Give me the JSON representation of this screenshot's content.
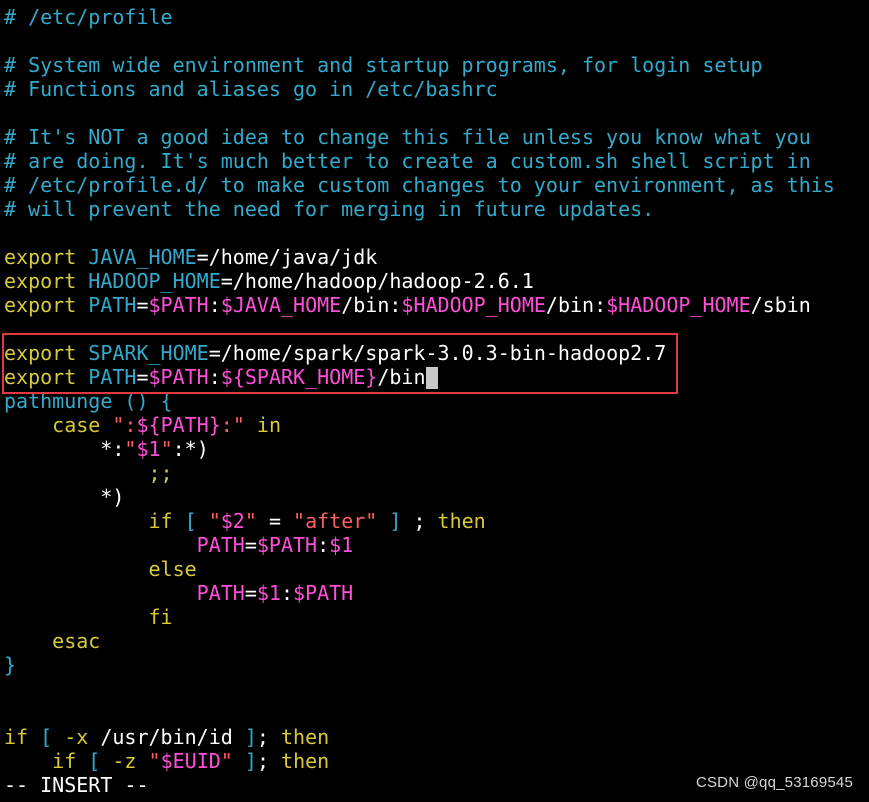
{
  "editor": {
    "colors": {
      "comment": "#33aacc",
      "keyword": "#d7c93a",
      "variable": "#33aacc",
      "text": "#ffffff",
      "reference": "#ff4fd8",
      "string": "#ff5f5f",
      "highlight_box": "#e0393e",
      "background": "#000000"
    },
    "lines": [
      [
        {
          "t": "# /etc/profile",
          "c": "comment"
        }
      ],
      [],
      [
        {
          "t": "# System wide environment and startup programs, for login setup",
          "c": "comment"
        }
      ],
      [
        {
          "t": "# Functions and aliases go in /etc/bashrc",
          "c": "comment"
        }
      ],
      [],
      [
        {
          "t": "# It's NOT a good idea to change this file unless you know what you",
          "c": "comment"
        }
      ],
      [
        {
          "t": "# are doing. It's much better to create a custom.sh shell script in",
          "c": "comment"
        }
      ],
      [
        {
          "t": "# /etc/profile.d/ to make custom changes to your environment, as this",
          "c": "comment"
        }
      ],
      [
        {
          "t": "# will prevent the need for merging in future updates.",
          "c": "comment"
        }
      ],
      [],
      [
        {
          "t": "export",
          "c": "keyword"
        },
        {
          "t": " ",
          "c": "text"
        },
        {
          "t": "JAVA_HOME",
          "c": "variable"
        },
        {
          "t": "=/home/java/jdk",
          "c": "text"
        }
      ],
      [
        {
          "t": "export",
          "c": "keyword"
        },
        {
          "t": " ",
          "c": "text"
        },
        {
          "t": "HADOOP_HOME",
          "c": "variable"
        },
        {
          "t": "=/home/hadoop/hadoop-2.6.1",
          "c": "text"
        }
      ],
      [
        {
          "t": "export",
          "c": "keyword"
        },
        {
          "t": " ",
          "c": "text"
        },
        {
          "t": "PATH",
          "c": "variable"
        },
        {
          "t": "=",
          "c": "text"
        },
        {
          "t": "$PATH",
          "c": "reference"
        },
        {
          "t": ":",
          "c": "text"
        },
        {
          "t": "$JAVA_HOME",
          "c": "reference"
        },
        {
          "t": "/bin:",
          "c": "text"
        },
        {
          "t": "$HADOOP_HOME",
          "c": "reference"
        },
        {
          "t": "/bin:",
          "c": "text"
        },
        {
          "t": "$HADOOP_HOME",
          "c": "reference"
        },
        {
          "t": "/sbin",
          "c": "text"
        }
      ],
      [],
      [
        {
          "t": "export",
          "c": "keyword"
        },
        {
          "t": " ",
          "c": "text"
        },
        {
          "t": "SPARK_HOME",
          "c": "variable"
        },
        {
          "t": "=/home/spark/spark-3.0.3-bin-hadoop2.7",
          "c": "text"
        }
      ],
      [
        {
          "t": "export",
          "c": "keyword"
        },
        {
          "t": " ",
          "c": "text"
        },
        {
          "t": "PATH",
          "c": "variable"
        },
        {
          "t": "=",
          "c": "text"
        },
        {
          "t": "$PATH",
          "c": "reference"
        },
        {
          "t": ":",
          "c": "text"
        },
        {
          "t": "${SPARK_HOME}",
          "c": "reference"
        },
        {
          "t": "/bin",
          "c": "text"
        },
        {
          "cursor": true
        }
      ],
      [
        {
          "t": "pathmunge () {",
          "c": "variable"
        }
      ],
      [
        {
          "t": "    ",
          "c": "text"
        },
        {
          "t": "case",
          "c": "keyword"
        },
        {
          "t": " ",
          "c": "text"
        },
        {
          "t": "\":",
          "c": "str"
        },
        {
          "t": "${PATH}",
          "c": "reference"
        },
        {
          "t": ":\"",
          "c": "str"
        },
        {
          "t": " ",
          "c": "text"
        },
        {
          "t": "in",
          "c": "keyword"
        }
      ],
      [
        {
          "t": "        *:",
          "c": "text"
        },
        {
          "t": "\"",
          "c": "str"
        },
        {
          "t": "$1",
          "c": "reference"
        },
        {
          "t": "\"",
          "c": "str"
        },
        {
          "t": ":*)",
          "c": "text"
        }
      ],
      [
        {
          "t": "            ",
          "c": "text"
        },
        {
          "t": ";;",
          "c": "keyword"
        }
      ],
      [
        {
          "t": "        *)",
          "c": "text"
        }
      ],
      [
        {
          "t": "            ",
          "c": "text"
        },
        {
          "t": "if",
          "c": "keyword"
        },
        {
          "t": " [ ",
          "c": "variable"
        },
        {
          "t": "\"",
          "c": "str"
        },
        {
          "t": "$2",
          "c": "reference"
        },
        {
          "t": "\"",
          "c": "str"
        },
        {
          "t": " = ",
          "c": "text"
        },
        {
          "t": "\"after\"",
          "c": "str"
        },
        {
          "t": " ] ",
          "c": "variable"
        },
        {
          "t": "; ",
          "c": "text"
        },
        {
          "t": "then",
          "c": "keyword"
        }
      ],
      [
        {
          "t": "                ",
          "c": "text"
        },
        {
          "t": "PATH",
          "c": "reference"
        },
        {
          "t": "=",
          "c": "text"
        },
        {
          "t": "$PATH",
          "c": "reference"
        },
        {
          "t": ":",
          "c": "text"
        },
        {
          "t": "$1",
          "c": "reference"
        }
      ],
      [
        {
          "t": "            ",
          "c": "text"
        },
        {
          "t": "else",
          "c": "keyword"
        }
      ],
      [
        {
          "t": "                ",
          "c": "text"
        },
        {
          "t": "PATH",
          "c": "reference"
        },
        {
          "t": "=",
          "c": "text"
        },
        {
          "t": "$1",
          "c": "reference"
        },
        {
          "t": ":",
          "c": "text"
        },
        {
          "t": "$PATH",
          "c": "reference"
        }
      ],
      [
        {
          "t": "            ",
          "c": "text"
        },
        {
          "t": "fi",
          "c": "keyword"
        }
      ],
      [
        {
          "t": "    ",
          "c": "text"
        },
        {
          "t": "esac",
          "c": "keyword"
        }
      ],
      [
        {
          "t": "}",
          "c": "variable"
        }
      ],
      [],
      [],
      [
        {
          "t": "if",
          "c": "keyword"
        },
        {
          "t": " [ ",
          "c": "variable"
        },
        {
          "t": "-x",
          "c": "keyword"
        },
        {
          "t": " /usr/bin/id ",
          "c": "text"
        },
        {
          "t": "]",
          "c": "variable"
        },
        {
          "t": "; ",
          "c": "text"
        },
        {
          "t": "then",
          "c": "keyword"
        }
      ],
      [
        {
          "t": "    ",
          "c": "text"
        },
        {
          "t": "if",
          "c": "keyword"
        },
        {
          "t": " [ ",
          "c": "variable"
        },
        {
          "t": "-z",
          "c": "keyword"
        },
        {
          "t": " ",
          "c": "text"
        },
        {
          "t": "\"",
          "c": "str"
        },
        {
          "t": "$EUID",
          "c": "reference"
        },
        {
          "t": "\"",
          "c": "str"
        },
        {
          "t": " ",
          "c": "text"
        },
        {
          "t": "]",
          "c": "variable"
        },
        {
          "t": "; ",
          "c": "text"
        },
        {
          "t": "then",
          "c": "keyword"
        }
      ]
    ],
    "status_mode": "-- INSERT --"
  },
  "watermark": "CSDN @qq_53169545"
}
